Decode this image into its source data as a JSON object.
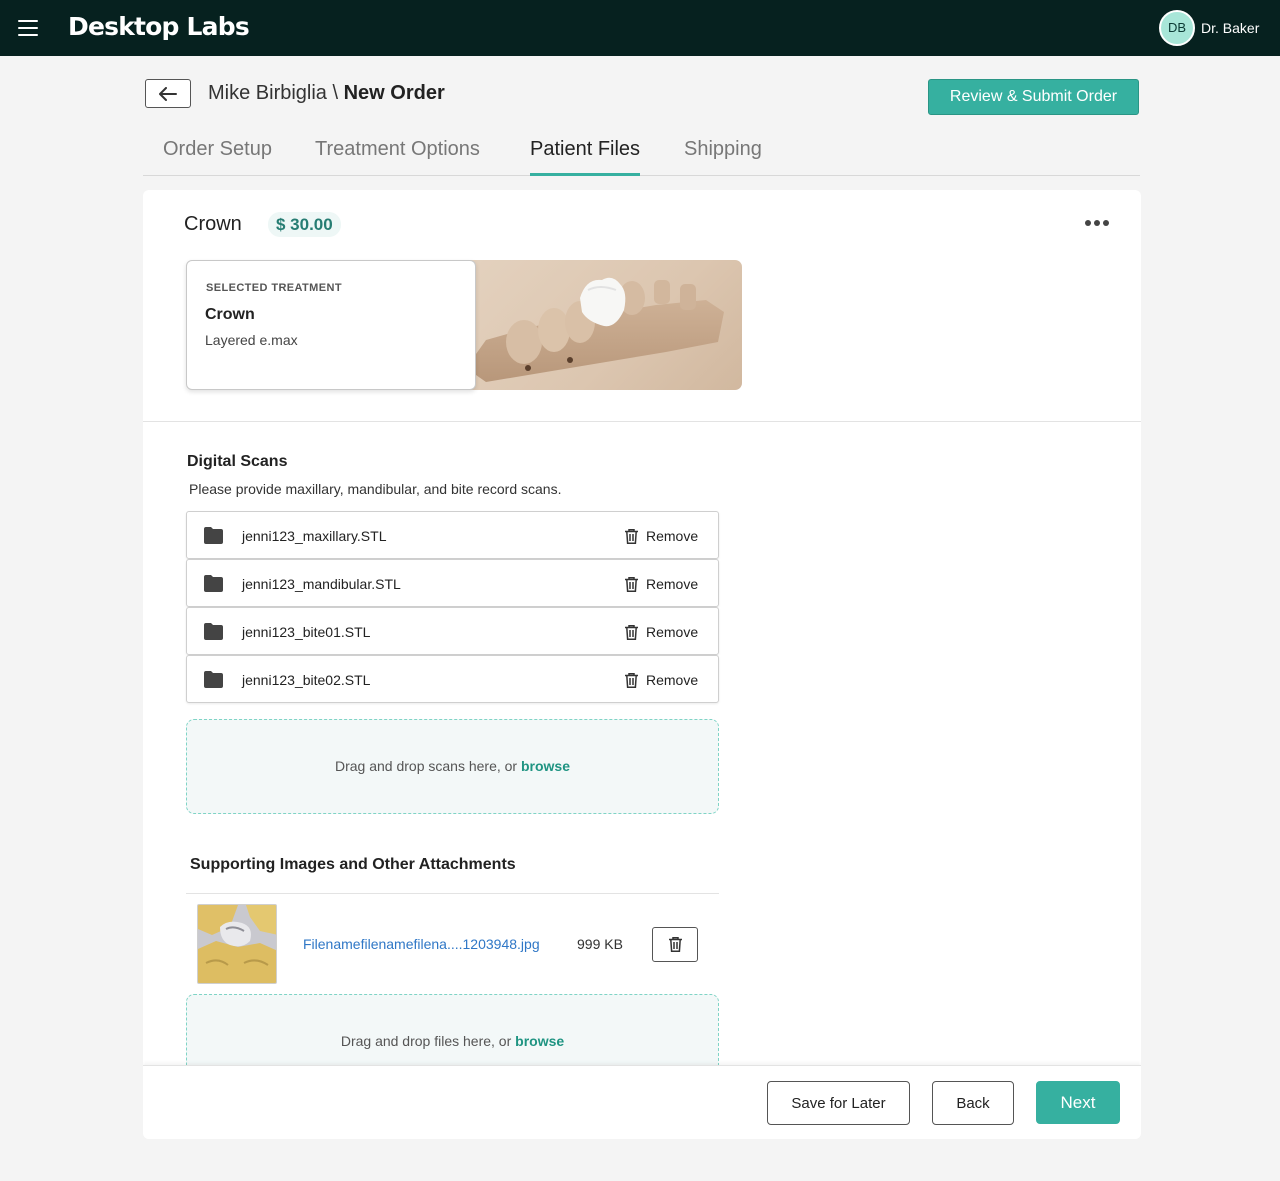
{
  "app": {
    "logo": "Desktop Labs",
    "user_initials": "DB",
    "user_name": "Dr. Baker"
  },
  "header": {
    "patient": "Mike Birbiglia \\",
    "page": "New Order",
    "submit_label": "Review & Submit Order"
  },
  "tabs": [
    {
      "label": "Order Setup"
    },
    {
      "label": "Treatment Options"
    },
    {
      "label": "Patient Files",
      "active": true
    },
    {
      "label": "Shipping"
    }
  ],
  "product": {
    "name": "Crown",
    "price": "$ 30.00"
  },
  "treatment": {
    "label": "SELECTED TREATMENT",
    "name": "Crown",
    "material": "Layered e.max"
  },
  "scans": {
    "title": "Digital Scans",
    "description": "Please provide maxillary, mandibular, and bite record scans.",
    "remove_label": "Remove",
    "files": [
      "jenni123_maxillary.STL",
      "jenni123_mandibular.STL",
      "jenni123_bite01.STL",
      "jenni123_bite02.STL"
    ],
    "drop_text": "Drag and drop scans here, or",
    "browse_label": "browse"
  },
  "attachments": {
    "title": "Supporting Images and Other Attachments",
    "files": [
      {
        "name": "Filenamefilenamefilena....1203948.jpg",
        "size": "999 KB"
      }
    ],
    "drop_text": "Drag and drop files here, or",
    "browse_label": "browse"
  },
  "footer": {
    "save_label": "Save for Later",
    "back_label": "Back",
    "next_label": "Next"
  },
  "colors": {
    "accent": "#36b0a0",
    "topbar": "#06211f",
    "link": "#2f77c6"
  },
  "icons": [
    "hamburger-icon",
    "arrow-left-icon",
    "more-horizontal-icon",
    "folder-icon",
    "trash-icon"
  ]
}
